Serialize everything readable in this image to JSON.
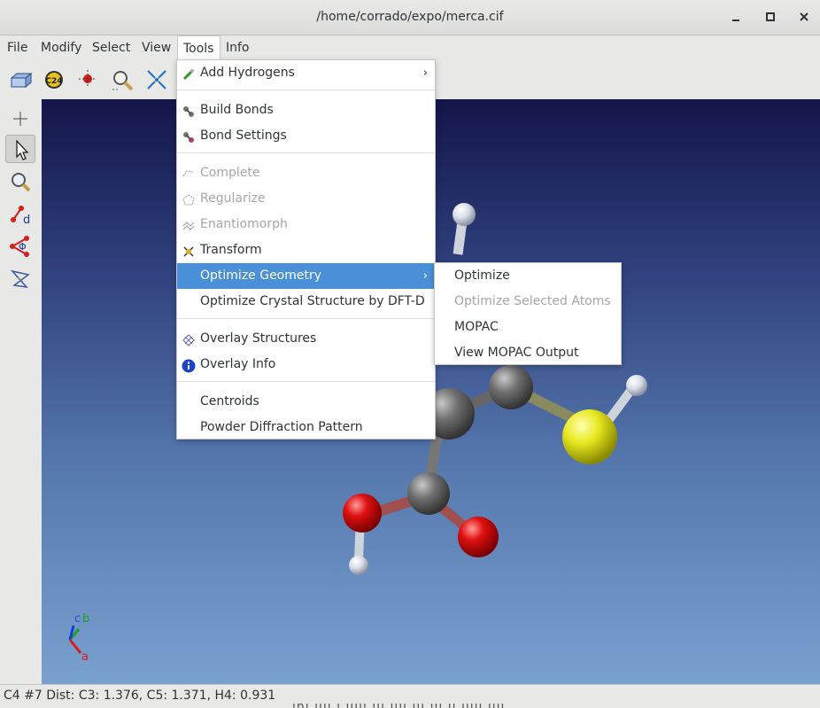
{
  "window": {
    "title": "/home/corrado/expo/merca.cif",
    "controls": [
      "minimize-icon",
      "maximize-icon",
      "close-icon"
    ]
  },
  "menubar": {
    "items": [
      "File",
      "Modify",
      "Select",
      "View",
      "Tools",
      "Info"
    ],
    "active": "Tools"
  },
  "toolbar": {
    "icons": [
      "cell-box-icon",
      "c24-label-icon",
      "atom-pick-icon",
      "zoom-icon",
      "fit-icon"
    ],
    "c24_label": "C24"
  },
  "left_tools": {
    "icons": [
      "translate-icon",
      "pointer-icon",
      "zoom-icon",
      "distance-icon",
      "angle-icon",
      "torsion-icon"
    ],
    "selected": "pointer-icon"
  },
  "tools_menu": {
    "items": [
      {
        "label": "Add Hydrogens",
        "icon": "add-hydrogens-icon",
        "submenu": true,
        "enabled": true
      },
      {
        "label": "Build Bonds",
        "icon": "build-bonds-icon",
        "enabled": true
      },
      {
        "label": "Bond Settings",
        "icon": "bond-settings-icon",
        "enabled": true
      },
      {
        "label": "Complete",
        "icon": "complete-icon",
        "enabled": false
      },
      {
        "label": "Regularize",
        "icon": "regularize-icon",
        "enabled": false
      },
      {
        "label": "Enantiomorph",
        "icon": "enantiomorph-icon",
        "enabled": false
      },
      {
        "label": "Transform",
        "icon": "transform-icon",
        "enabled": true
      },
      {
        "label": "Optimize Geometry",
        "submenu": true,
        "enabled": true,
        "highlighted": true
      },
      {
        "label": "Optimize Crystal Structure by DFT-D",
        "enabled": true
      },
      {
        "label": "Overlay Structures",
        "icon": "overlay-structures-icon",
        "enabled": true
      },
      {
        "label": "Overlay Info",
        "icon": "info-icon",
        "enabled": true
      },
      {
        "label": "Centroids",
        "enabled": true
      },
      {
        "label": "Powder Diffraction Pattern",
        "enabled": true
      }
    ]
  },
  "optimize_submenu": {
    "items": [
      {
        "label": "Optimize",
        "enabled": true
      },
      {
        "label": "Optimize Selected Atoms",
        "enabled": false
      },
      {
        "label": "MOPAC",
        "enabled": true
      },
      {
        "label": "View MOPAC Output",
        "enabled": true
      }
    ]
  },
  "axes": {
    "c": "c",
    "b": "b",
    "a": "a"
  },
  "status": {
    "text": "C4 #7 Dist: C3: 1.376, C5: 1.371, H4: 0.931",
    "ghost": "ını ıııı ı ııııı ııı ıııı ııı ııı ıı ııııı ıııı"
  },
  "colors": {
    "highlight": "#4a90d9",
    "viewport_top": "#131548",
    "viewport_bottom": "#79a1cf",
    "carbon": "#6a6a6a",
    "oxygen": "#e01010",
    "sulfur": "#e8e820",
    "hydrogen": "#d8dde8"
  }
}
